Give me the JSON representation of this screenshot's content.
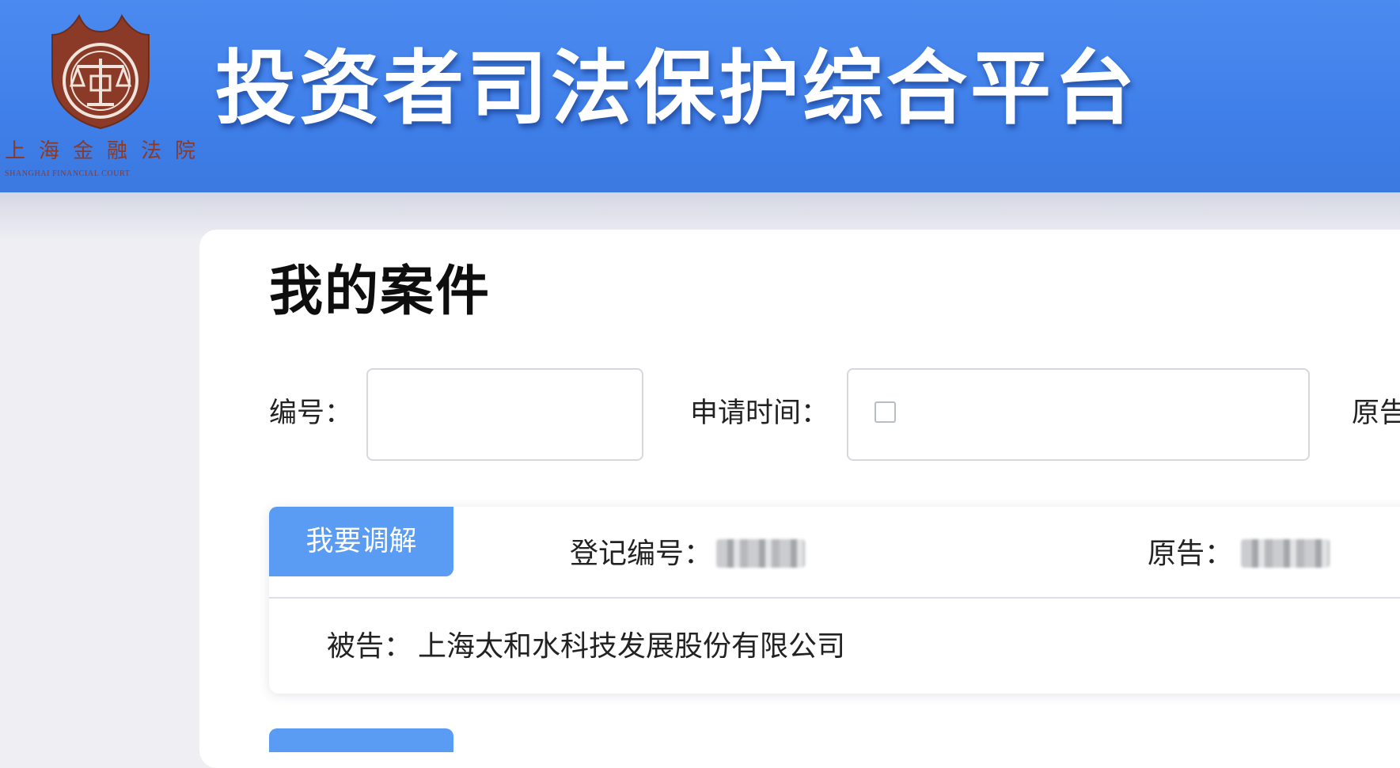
{
  "header": {
    "court_name_cn": "上海金融法院",
    "court_name_en": "SHANGHAI FINANCIAL COURT",
    "platform_title": "投资者司法保护综合平台",
    "colors": {
      "header_blue": "#4284ec",
      "emblem_brown": "#8a3a26"
    }
  },
  "main": {
    "page_title": "我的案件",
    "filters": {
      "number_label": "编号：",
      "number_value": "",
      "apply_time_label": "申请时间：",
      "plaintiff_label": "原告"
    },
    "case_card": {
      "mediate_button_label": "我要调解",
      "registration_label": "登记编号：",
      "plaintiff_label": "原告：",
      "defendant_label": "被告：",
      "defendant_value": "上海太和水科技发展股份有限公司"
    }
  }
}
